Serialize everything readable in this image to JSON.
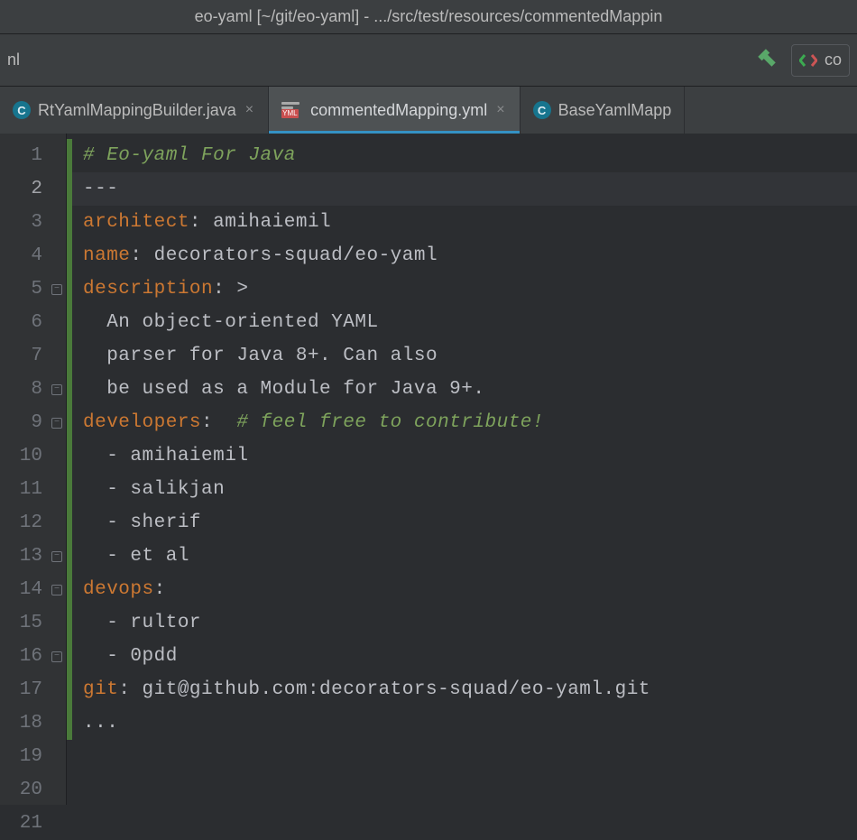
{
  "title": "eo-yaml [~/git/eo-yaml] - .../src/test/resources/commentedMappin",
  "breadcrumb_tail": "nl",
  "runconfig_label": "co",
  "tabs": [
    {
      "label": "RtYamlMappingBuilder.java",
      "closable": true,
      "icon": "java-class-icon"
    },
    {
      "label": "commentedMapping.yml",
      "closable": true,
      "icon": "yml-file-icon",
      "active": true
    },
    {
      "label": "BaseYamlMapp",
      "closable": false,
      "icon": "java-class-icon"
    }
  ],
  "code": {
    "lines": [
      {
        "n": 1,
        "segs": [
          {
            "t": "# Eo-yaml For Java",
            "c": "cmt"
          }
        ]
      },
      {
        "n": 2,
        "current": true,
        "segs": [
          {
            "t": "---",
            "c": "txt"
          }
        ]
      },
      {
        "n": 3,
        "segs": [
          {
            "t": "architect",
            "c": "key"
          },
          {
            "t": ": amihaiemil",
            "c": "txt"
          }
        ]
      },
      {
        "n": 4,
        "segs": [
          {
            "t": "name",
            "c": "key"
          },
          {
            "t": ": decorators-squad/eo-yaml",
            "c": "txt"
          }
        ]
      },
      {
        "n": 5,
        "fold": true,
        "segs": [
          {
            "t": "description",
            "c": "key"
          },
          {
            "t": ": >",
            "c": "txt"
          }
        ]
      },
      {
        "n": 6,
        "segs": [
          {
            "t": "  An object-oriented YAML",
            "c": "txt"
          }
        ]
      },
      {
        "n": 7,
        "segs": [
          {
            "t": "  parser for Java 8+. Can also",
            "c": "txt"
          }
        ]
      },
      {
        "n": 8,
        "fold": true,
        "segs": [
          {
            "t": "  be used as a Module for Java 9+.",
            "c": "txt"
          }
        ]
      },
      {
        "n": 9,
        "fold": true,
        "segs": [
          {
            "t": "developers",
            "c": "key"
          },
          {
            "t": ":  ",
            "c": "txt"
          },
          {
            "t": "# feel free to contribute!",
            "c": "cmt"
          }
        ]
      },
      {
        "n": 10,
        "segs": [
          {
            "t": "  - amihaiemil",
            "c": "txt"
          }
        ]
      },
      {
        "n": 11,
        "segs": [
          {
            "t": "  - salikjan",
            "c": "txt"
          }
        ]
      },
      {
        "n": 12,
        "segs": [
          {
            "t": "  - sherif",
            "c": "txt"
          }
        ]
      },
      {
        "n": 13,
        "fold": true,
        "segs": [
          {
            "t": "  - et al",
            "c": "txt"
          }
        ]
      },
      {
        "n": 14,
        "fold": true,
        "segs": [
          {
            "t": "devops",
            "c": "key"
          },
          {
            "t": ":",
            "c": "txt"
          }
        ]
      },
      {
        "n": 15,
        "segs": [
          {
            "t": "  - rultor",
            "c": "txt"
          }
        ]
      },
      {
        "n": 16,
        "fold": true,
        "segs": [
          {
            "t": "  - 0pdd",
            "c": "txt"
          }
        ]
      },
      {
        "n": 17,
        "segs": [
          {
            "t": "git",
            "c": "key"
          },
          {
            "t": ": git@github.com:decorators-squad/eo-yaml.git",
            "c": "txt"
          }
        ]
      },
      {
        "n": 18,
        "segs": [
          {
            "t": "...",
            "c": "txt"
          }
        ]
      },
      {
        "n": 19,
        "segs": []
      },
      {
        "n": 20,
        "segs": []
      },
      {
        "n": 21,
        "segs": []
      }
    ]
  }
}
